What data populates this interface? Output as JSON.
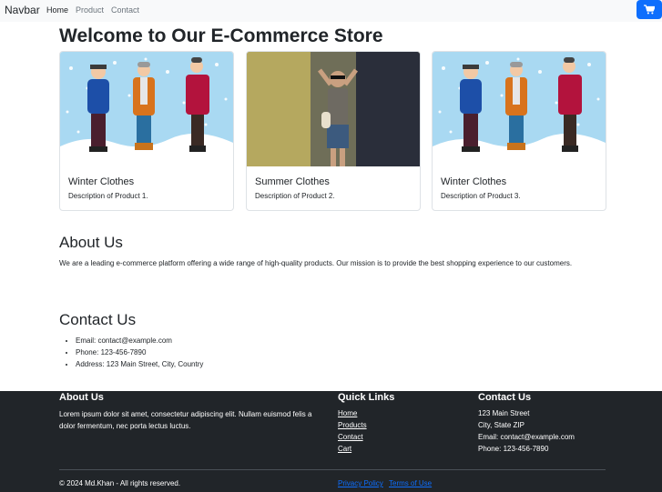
{
  "navbar": {
    "brand": "Navbar",
    "links": [
      "Home",
      "Product",
      "Contact"
    ],
    "cart_icon": "cart-icon"
  },
  "main": {
    "title": "Welcome to Our E-Commerce Store",
    "cards": [
      {
        "title": "Winter Clothes",
        "description": "Description of Product 1.",
        "image": "winter-clothes-illustration"
      },
      {
        "title": "Summer Clothes",
        "description": "Description of Product 2.",
        "image": "summer-clothes-photo"
      },
      {
        "title": "Winter Clothes",
        "description": "Description of Product 3.",
        "image": "winter-clothes-illustration"
      }
    ]
  },
  "about": {
    "title": "About Us",
    "text": "We are a leading e-commerce platform offering a wide range of high-quality products. Our mission is to provide the best shopping experience to our customers."
  },
  "contact": {
    "title": "Contact Us",
    "items": [
      "Email: contact@example.com",
      "Phone: 123-456-7890",
      "Address: 123 Main Street, City, Country"
    ]
  },
  "footer": {
    "about_title": "About Us",
    "about_text": "Lorem ipsum dolor sit amet, consectetur adipiscing elit. Nullam euismod felis a dolor fermentum, nec porta lectus luctus.",
    "links_title": "Quick Links",
    "links": [
      "Home",
      "Products",
      "Contact",
      "Cart"
    ],
    "contact_title": "Contact Us",
    "contact_lines": [
      "123 Main Street",
      "City, State ZIP",
      "Email: contact@example.com",
      "Phone: 123-456-7890"
    ],
    "copyright": "© 2024 Md.Khan - All rights reserved.",
    "privacy": "Privacy Policy",
    "terms": "Terms of Use"
  },
  "colors": {
    "primary": "#0d6efd",
    "navbar_bg": "#f8f9fa",
    "footer_bg": "#212529"
  }
}
